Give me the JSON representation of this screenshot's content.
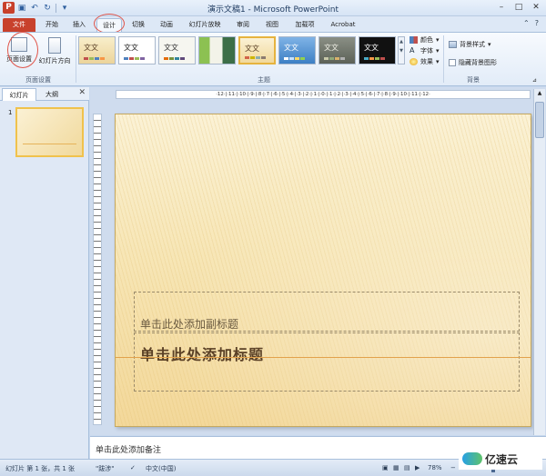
{
  "window": {
    "title": "演示文稿1 - Microsoft PowerPoint",
    "controls": [
      "–",
      "□",
      "✕"
    ]
  },
  "tabs": [
    "文件",
    "开始",
    "插入",
    "设计",
    "切换",
    "动画",
    "幻灯片放映",
    "审阅",
    "视图",
    "加载项",
    "Acrobat"
  ],
  "ribbon": {
    "page_setup": {
      "page_setup_label": "页面设置",
      "orientation_label": "幻灯片方向",
      "group_label": "页面设置"
    },
    "themes": {
      "group_label": "主题",
      "items": [
        "文文",
        "文文",
        "文文",
        "",
        "文文",
        "文文",
        "文文",
        "文文"
      ]
    },
    "theme_options": {
      "colors": "颜色",
      "fonts": "字体",
      "effects": "效果"
    },
    "background": {
      "styles": "背景样式",
      "hide_graphics": "隐藏背景图形",
      "group_label": "背景"
    }
  },
  "left_pane": {
    "tabs": [
      "幻灯片",
      "大纲"
    ],
    "slide_number": "1"
  },
  "ruler": {
    "marks": "·12·|·11·|·10·|·9·|·8·|·7·|·6·|·5·|·4·|·3·|·2·|·1·|·0·|·1·|·2·|·3·|·4·|·5·|·6·|·7·|·8·|·9·|·10·|·11·|·12·"
  },
  "slide": {
    "subtitle_placeholder": "单击此处添加副标题",
    "title_placeholder": "单击此处添加标题"
  },
  "notes": {
    "placeholder": "单击此处添加备注"
  },
  "status": {
    "slide_info": "幻灯片 第 1 张，共 1 张",
    "theme_name": "\"跋涉\"",
    "language": "中文(中国)",
    "zoom": "78%",
    "zoom_fraction": 0.62
  },
  "watermark": {
    "text": "亿速云"
  }
}
